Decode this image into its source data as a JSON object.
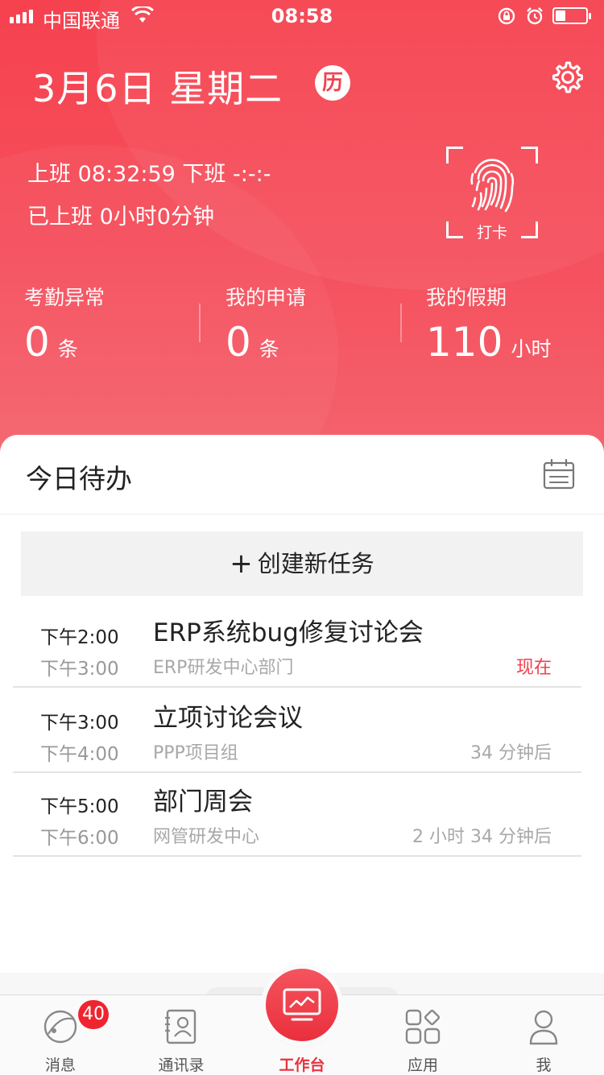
{
  "status_bar": {
    "carrier": "中国联通",
    "time": "08:58"
  },
  "header": {
    "date": "3月6日 星期二",
    "calendar_badge": "历",
    "clock_in_line": "上班 08:32:59 下班 -:-:-",
    "worked_line": "已上班 0小时0分钟",
    "punch_label": "打卡"
  },
  "stats": [
    {
      "title": "考勤异常",
      "value": "0",
      "unit": "条"
    },
    {
      "title": "我的申请",
      "value": "0",
      "unit": "条"
    },
    {
      "title": "我的假期",
      "value": "110",
      "unit": "小时"
    }
  ],
  "todo": {
    "title": "今日待办",
    "create_label": "创建新任务",
    "tasks": [
      {
        "start": "下午2:00",
        "end": "下午3:00",
        "title": "ERP系统bug修复讨论会",
        "org": "ERP研发中心部门",
        "when": "现在"
      },
      {
        "start": "下午3:00",
        "end": "下午4:00",
        "title": "立项讨论会议",
        "org": "PPP项目组",
        "when": "34 分钟后"
      },
      {
        "start": "下午5:00",
        "end": "下午6:00",
        "title": "部门周会",
        "org": "网管研发中心",
        "when": "2 小时 34 分钟后"
      }
    ]
  },
  "tabbar": {
    "items": [
      {
        "label": "消息",
        "icon": "message-icon",
        "badge": "40"
      },
      {
        "label": "通讯录",
        "icon": "contacts-icon"
      },
      {
        "label": "工作台",
        "icon": "workbench-icon",
        "active": true
      },
      {
        "label": "应用",
        "icon": "apps-icon"
      },
      {
        "label": "我",
        "icon": "profile-icon"
      }
    ]
  },
  "colors": {
    "brand_red": "#f0424f",
    "badge_red": "#f0242e",
    "muted_text": "#a8a8a8"
  }
}
